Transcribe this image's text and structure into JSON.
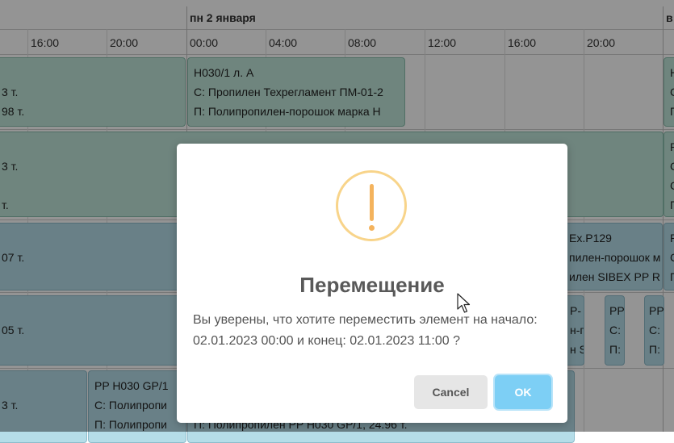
{
  "scheduler": {
    "dates": [
      {
        "label": "пн 2 января"
      },
      {
        "label": "в"
      }
    ],
    "times": [
      "16:00",
      "20:00",
      "00:00",
      "04:00",
      "08:00",
      "12:00",
      "16:00",
      "20:00"
    ],
    "events": [
      {
        "lines": [
          "",
          "3 т.",
          "98 т."
        ],
        "color": "green"
      },
      {
        "lines": [
          "Н030/1 л. А",
          "С: Пропилен Техрегламент ПМ-01-2",
          "П: Полипропилен-порошок марка Н"
        ],
        "color": "green"
      },
      {
        "lines": [
          "Н",
          "С",
          "П"
        ],
        "color": "green"
      },
      {
        "lines": [
          "",
          "3 т.",
          "",
          "т."
        ],
        "color": "green"
      },
      {
        "lines": [
          "R",
          "С",
          "С",
          "П"
        ],
        "color": "green"
      },
      {
        "lines": [
          "",
          "07 т."
        ],
        "color": "blue"
      },
      {
        "lines": [
          "Ex.P129",
          "пилен-порошок м",
          "илен SIBEX PP R"
        ],
        "color": "blue"
      },
      {
        "lines": [
          "P",
          "С",
          "П"
        ],
        "color": "blue"
      },
      {
        "lines": [
          "",
          "05 т."
        ],
        "color": "blue"
      },
      {
        "lines": [
          "P-",
          "н-п",
          "н S"
        ],
        "color": "blue"
      },
      {
        "lines": [
          "PP",
          "С:",
          "П:"
        ],
        "color": "blue"
      },
      {
        "lines": [
          "PP",
          "С:",
          "П:"
        ],
        "color": "blue"
      },
      {
        "lines": [
          "",
          "3 т."
        ],
        "color": "blue"
      },
      {
        "lines": [
          "PP Н030 GP/1",
          "С: Полипропи",
          "П: Полипропи"
        ],
        "color": "blue"
      },
      {
        "lines": [
          "",
          "",
          "П: Полипропилен PP Н030 GP/1, 24.96 т."
        ],
        "color": "blue"
      }
    ]
  },
  "dialog": {
    "icon": "warning-icon",
    "title": "Перемещение",
    "message": "Вы уверены, что хотите переместить элемент на начало: 02.01.2023 00:00 и конец: 02.01.2023 11:00 ?",
    "cancel_label": "Cancel",
    "ok_label": "OK"
  },
  "colors": {
    "event_green": "#bfe6da",
    "event_blue": "#b5dde8",
    "warning": "#f4b35d",
    "ok_button": "#7dcff5"
  }
}
